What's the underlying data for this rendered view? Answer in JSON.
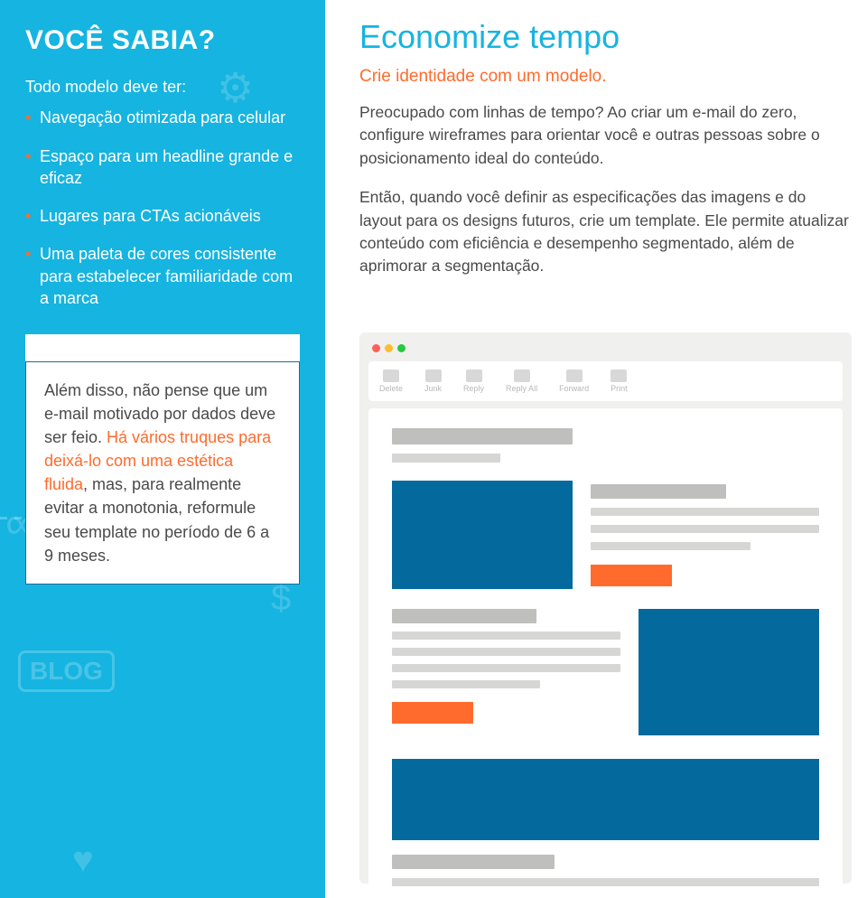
{
  "left": {
    "title": "VOCÊ SABIA?",
    "intro": "Todo modelo deve ter:",
    "items": [
      "Navegação otimizada para celular",
      "Espaço para um headline grande e eficaz",
      "Lugares para CTAs acionáveis",
      "Uma paleta de cores consistente para estabelecer familiaridade com a marca"
    ]
  },
  "callout": {
    "part1": "Além disso, não pense que um e-mail motivado por dados deve ser feio. ",
    "link": "Há vários truques para deixá-lo com uma estética fluida",
    "part2": ", mas, para realmente evitar a monotonia, reformule seu template no período de 6 a 9 meses."
  },
  "right": {
    "heading": "Economize tempo",
    "subheading": "Crie identidade com um modelo.",
    "para1": "Preocupado com linhas de tempo? Ao criar um e-mail do zero, configure wireframes para orientar você e outras pessoas sobre o posicionamento ideal do conteúdo.",
    "para2": "Então, quando você definir as especificações das imagens e do layout para os designs futuros, crie um template. Ele permite atualizar conteúdo com eficiência e desempenho segmentado, além de aprimorar a segmentação."
  },
  "wireframe": {
    "toolbar": [
      "Delete",
      "Junk",
      "Reply",
      "Reply All",
      "Forward",
      "Print"
    ]
  }
}
